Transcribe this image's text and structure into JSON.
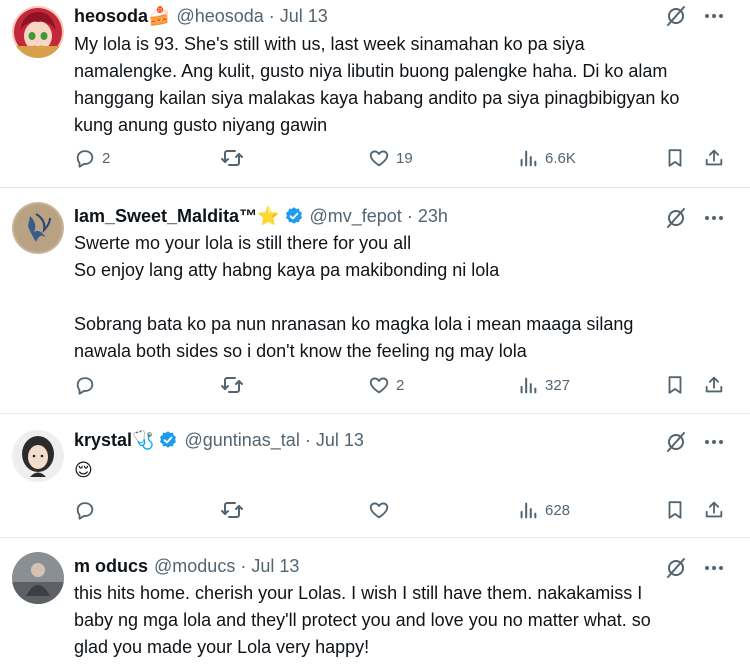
{
  "tweets": [
    {
      "name": "heosoda",
      "name_emoji": "🍰",
      "handle": "@heosoda",
      "time": "Jul 13",
      "text": [
        "My lola is 93. She's still with us, last week sinamahan ko pa siya",
        "namalengke. Ang kulit, gusto niya libutin buong palengke haha. Di ko alam",
        "hanggang kailan siya malakas kaya habang andito pa siya pinagbibigyan ko",
        "kung anung gusto niyang gawin"
      ],
      "replies": "2",
      "retweets": "",
      "likes": "19",
      "views": "6.6K"
    },
    {
      "name": "Iam_Sweet_Maldita™",
      "name_emoji": "⭐",
      "verified": true,
      "handle": "@mv_fepot",
      "time": "23h",
      "text": [
        "Swerte mo your lola is still there for you all",
        "So enjoy lang atty habng kaya pa makibonding ni lola",
        "",
        "Sobrang bata ko pa nun nranasan ko magka lola i mean maaga silang",
        "nawala both sides so i don't know the feeling ng may lola"
      ],
      "replies": "",
      "retweets": "",
      "likes": "2",
      "views": "327"
    },
    {
      "name": "krystal",
      "name_emoji": "🩺",
      "verified": true,
      "handle": "@guntinas_tal",
      "time": "Jul 13",
      "text": [
        "😌"
      ],
      "replies": "",
      "retweets": "",
      "likes": "",
      "views": "628"
    },
    {
      "name": "m oducs",
      "handle": "@moducs",
      "time": "Jul 13",
      "text": [
        "this hits home. cherish your Lolas. I wish I still have them. nakakamiss I",
        "baby ng mga lola and they'll protect you and love you no matter what. so",
        "glad you made your Lola very happy!"
      ]
    }
  ],
  "separator": "·",
  "colors": {
    "text": "#0f1419",
    "secondary": "#536471",
    "verified": "#1d9bf0",
    "divider": "#e6e9eb"
  },
  "icons": [
    "reply-icon",
    "retweet-icon",
    "like-icon",
    "views-icon",
    "bookmark-icon",
    "share-icon",
    "grok-icon",
    "more-icon",
    "verified-badge-icon"
  ]
}
